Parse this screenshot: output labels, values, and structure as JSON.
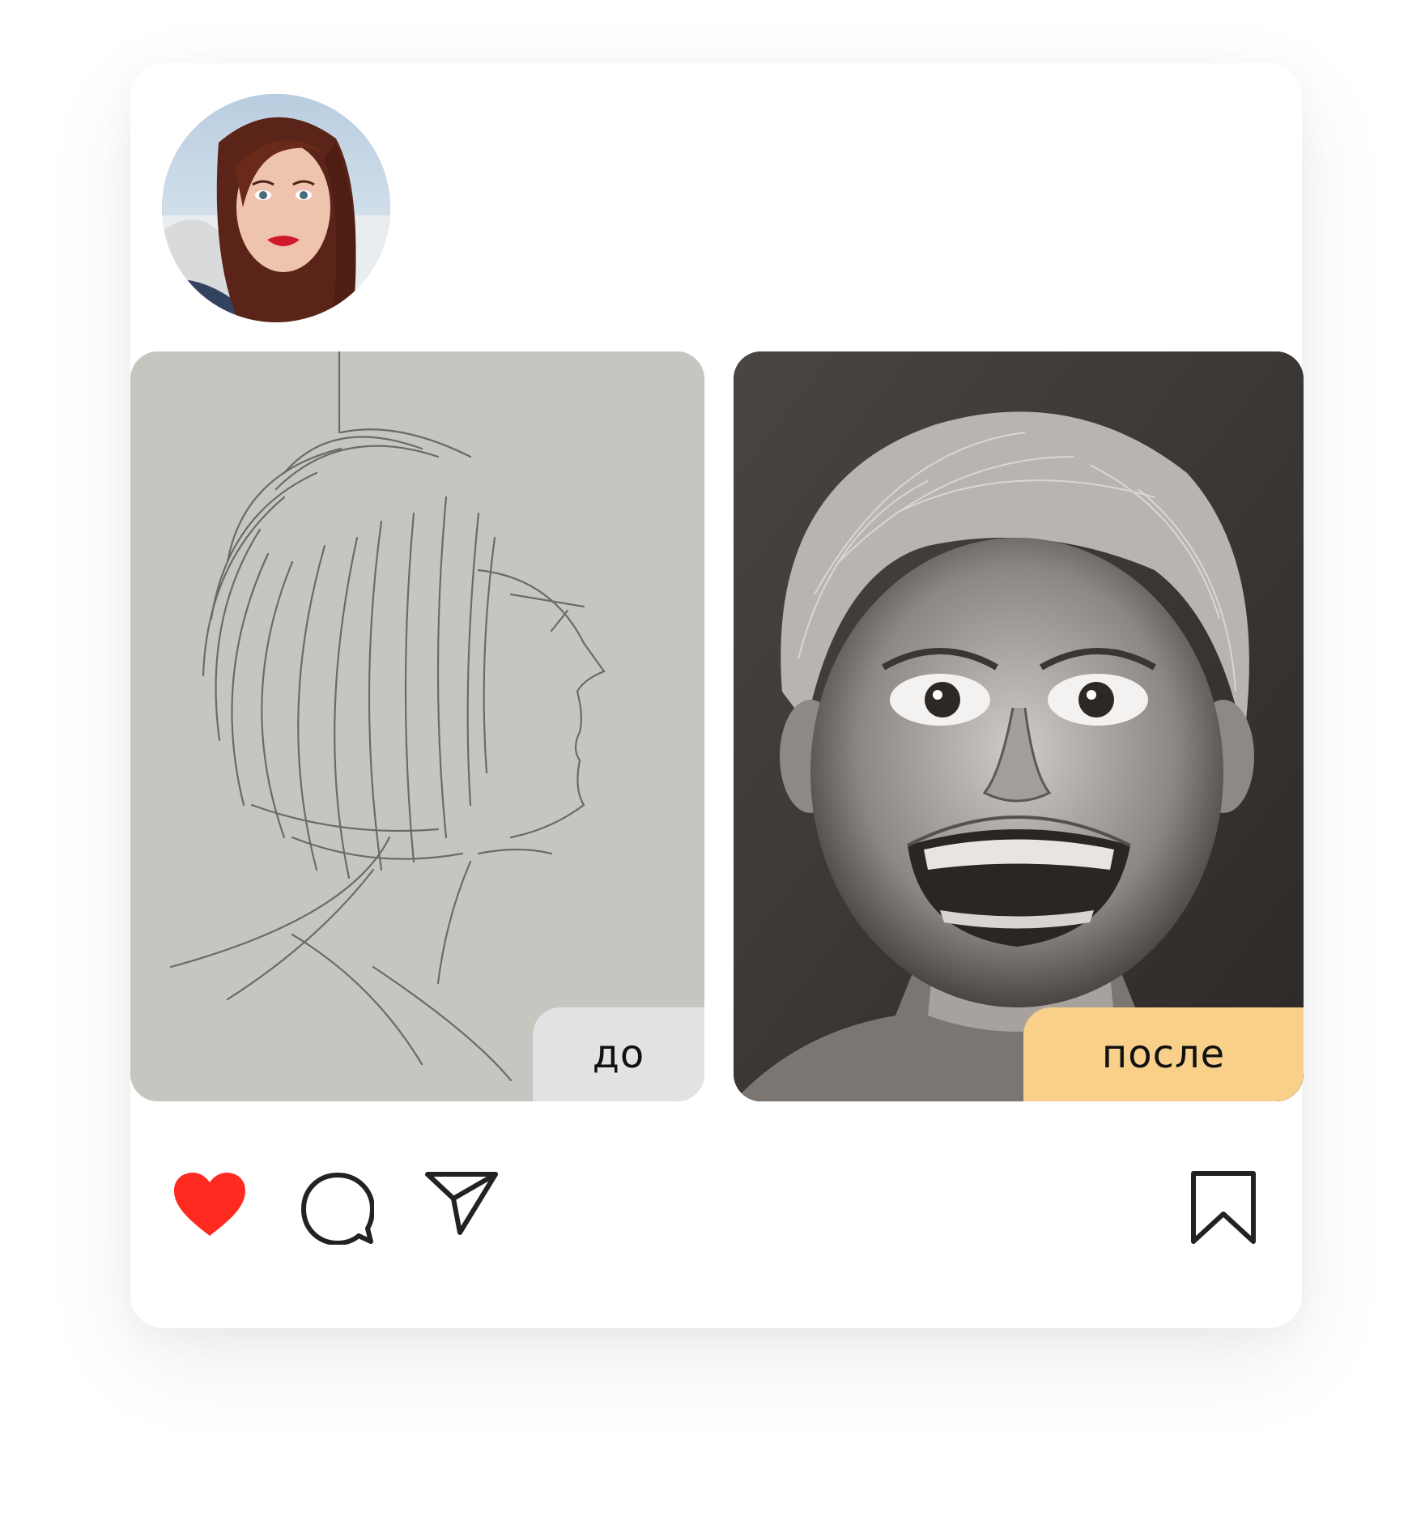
{
  "post": {
    "avatar_icon": "profile-photo",
    "images": [
      {
        "id": "before",
        "icon": "pencil-sketch-profile"
      },
      {
        "id": "after",
        "icon": "pencil-portrait-smiling-boy"
      }
    ],
    "badges": {
      "before_label": "до",
      "after_label": "после"
    },
    "actions": {
      "like": {
        "icon": "heart-icon",
        "active": true,
        "color": "#ff2a1f"
      },
      "comment": {
        "icon": "comment-icon"
      },
      "share": {
        "icon": "send-icon"
      },
      "save": {
        "icon": "bookmark-icon"
      }
    },
    "colors": {
      "before_badge": "#e2e2e2",
      "after_badge": "#f8d08a",
      "icon_stroke": "#222222"
    }
  }
}
